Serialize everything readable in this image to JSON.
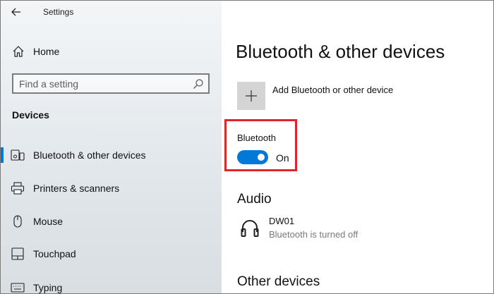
{
  "window": {
    "title": "Settings"
  },
  "sidebar": {
    "home_label": "Home",
    "search": {
      "placeholder": "Find a setting"
    },
    "section_label": "Devices",
    "items": [
      {
        "label": "Bluetooth & other devices",
        "icon": "bluetooth-devices-icon",
        "selected": true
      },
      {
        "label": "Printers & scanners",
        "icon": "printer-icon",
        "selected": false
      },
      {
        "label": "Mouse",
        "icon": "mouse-icon",
        "selected": false
      },
      {
        "label": "Touchpad",
        "icon": "touchpad-icon",
        "selected": false
      },
      {
        "label": "Typing",
        "icon": "keyboard-icon",
        "selected": false
      }
    ]
  },
  "main": {
    "title": "Bluetooth & other devices",
    "add_device_label": "Add Bluetooth or other device",
    "bluetooth": {
      "label": "Bluetooth",
      "state": "On",
      "enabled": true
    },
    "audio": {
      "title": "Audio",
      "devices": [
        {
          "name": "DW01",
          "status": "Bluetooth is turned off",
          "icon": "headphones-icon"
        }
      ]
    },
    "other_devices_title": "Other devices"
  },
  "colors": {
    "accent": "#0078d7",
    "highlight": "#e0242a",
    "muted_text": "#7a7a7a"
  }
}
